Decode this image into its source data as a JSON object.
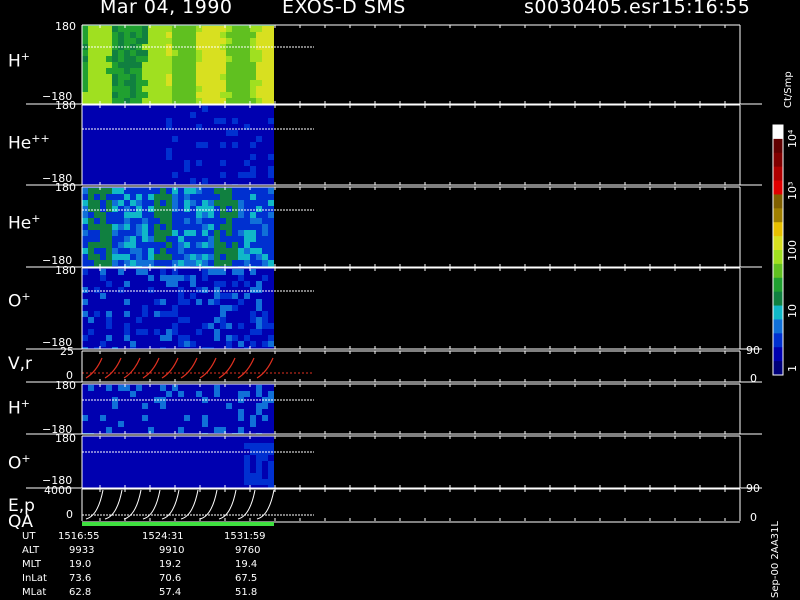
{
  "header": {
    "date": "Mar 04, 1990",
    "instrument": "EXOS-D SMS",
    "file": "s0030405.esr",
    "time": "15:16:55"
  },
  "version_label": "Sep-00 2AA31L",
  "colors": {
    "background": "#000000",
    "axis": "#ffffff",
    "velocity_trace": "#e03020",
    "qa_bar": "#40e040",
    "colorbar": [
      "#00007a",
      "#0000b0",
      "#0030d0",
      "#1070d8",
      "#10b8c8",
      "#108040",
      "#20a030",
      "#60c020",
      "#a0e020",
      "#d8e020",
      "#e8c000",
      "#a08000",
      "#806000",
      "#e00000",
      "#b00000",
      "#800000",
      "#600000",
      "#ffffff"
    ]
  },
  "colorbar": {
    "unit": "Ct/Smp",
    "ticks": [
      "1",
      "10",
      "100",
      "10³",
      "10⁴"
    ]
  },
  "panels": [
    {
      "id": "h-plus",
      "label": "H",
      "charge": "+",
      "ymax": "180",
      "ymin": "−180",
      "right_top": "",
      "right_bottom": ""
    },
    {
      "id": "he-plusplus",
      "label": "He",
      "charge": "++",
      "ymax": "180",
      "ymin": "−180",
      "right_top": "",
      "right_bottom": ""
    },
    {
      "id": "he-plus",
      "label": "He",
      "charge": "+",
      "ymax": "180",
      "ymin": "−180",
      "right_top": "",
      "right_bottom": ""
    },
    {
      "id": "o-plus",
      "label": "O",
      "charge": "+",
      "ymax": "180",
      "ymin": "−180",
      "right_top": "",
      "right_bottom": ""
    },
    {
      "id": "vr",
      "label": "V,r",
      "charge": "",
      "ymax": "25",
      "ymin": "0",
      "right_top": "90",
      "right_bottom": "0"
    },
    {
      "id": "h-plus-2",
      "label": "H",
      "charge": "+",
      "ymax": "180",
      "ymin": "−180",
      "right_top": "",
      "right_bottom": ""
    },
    {
      "id": "o-plus-2",
      "label": "O",
      "charge": "+",
      "ymax": "180",
      "ymin": "−180",
      "right_top": "",
      "right_bottom": ""
    },
    {
      "id": "ep",
      "label": "E,p",
      "charge": "",
      "ymax": "4000",
      "ymin": "0",
      "right_top": "90",
      "right_bottom": "0"
    }
  ],
  "qa_label": "QA",
  "ephemeris": {
    "rows": [
      {
        "label": "UT",
        "values": [
          "1516:55",
          "1524:31",
          "1531:59"
        ]
      },
      {
        "label": "ALT",
        "values": [
          "9933",
          "9910",
          "9760"
        ]
      },
      {
        "label": "MLT",
        "values": [
          "19.0",
          "19.2",
          "19.4"
        ]
      },
      {
        "label": "InLat",
        "values": [
          "73.6",
          "70.6",
          "67.5"
        ]
      },
      {
        "label": "MLat",
        "values": [
          "62.8",
          "57.4",
          "51.8"
        ]
      }
    ]
  },
  "chart_data": {
    "type": "heatmap",
    "title": "EXOS-D SMS",
    "subtitle": "Mar 04, 1990",
    "x_ticks": [
      "1516:55",
      "1524:31",
      "1531:59"
    ],
    "panels": [
      "H+",
      "He++",
      "He+",
      "O+",
      "V,r",
      "H+",
      "O+",
      "E,p"
    ],
    "y_range_pitch_deg": [
      -180,
      180
    ],
    "data_coverage_fraction": 0.42,
    "colorbar_unit": "Ct/Smp",
    "colorbar_scale": "log",
    "colorbar_range": [
      1,
      10000
    ]
  }
}
